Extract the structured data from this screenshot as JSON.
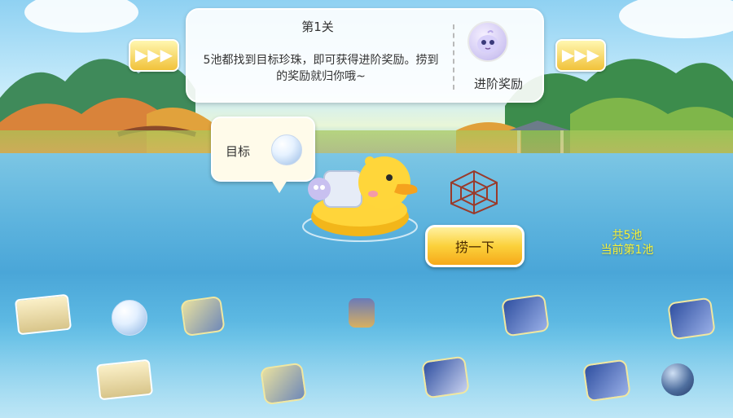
{
  "header": {
    "level_title": "第1关",
    "description": "5池都找到目标珍珠，即可获得进阶奖励。捞到的奖励就归你哦~",
    "reward_label": "进阶奖励",
    "arrow_left_icon": "fast-forward-icon",
    "arrow_right_icon": "fast-forward-icon"
  },
  "target": {
    "label": "目标",
    "icon": "pearl-icon"
  },
  "actions": {
    "scoop_label": "捞一下"
  },
  "pool_status": {
    "total": "共5池",
    "current": "当前第1池"
  },
  "colors": {
    "button_gold": "#fbd13b",
    "pool_text": "#f7f23a"
  },
  "pond_items": [
    {
      "name": "treasure-map-icon"
    },
    {
      "name": "pearl-icon"
    },
    {
      "name": "puzzle-piece-icon"
    },
    {
      "name": "character-figure-icon"
    },
    {
      "name": "puzzle-piece-icon"
    },
    {
      "name": "puzzle-piece-icon"
    },
    {
      "name": "treasure-map-icon"
    },
    {
      "name": "puzzle-piece-icon"
    },
    {
      "name": "puzzle-piece-icon"
    },
    {
      "name": "puzzle-piece-icon"
    },
    {
      "name": "dark-pearl-icon"
    }
  ]
}
